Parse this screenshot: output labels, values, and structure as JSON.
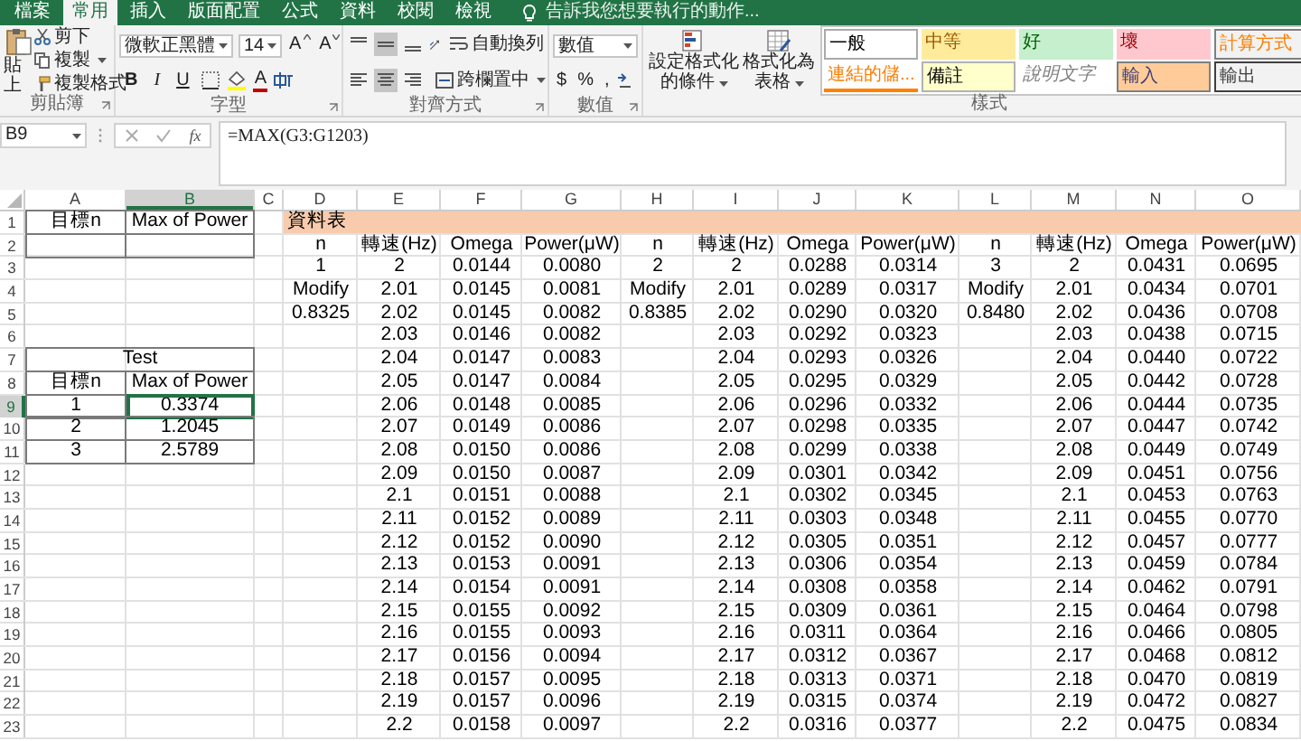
{
  "ribbon_tabs": [
    {
      "label": "檔案",
      "selected": false
    },
    {
      "label": "常用",
      "selected": true
    },
    {
      "label": "插入",
      "selected": false
    },
    {
      "label": "版面配置",
      "selected": false
    },
    {
      "label": "公式",
      "selected": false
    },
    {
      "label": "資料",
      "selected": false
    },
    {
      "label": "校閱",
      "selected": false
    },
    {
      "label": "檢視",
      "selected": false
    }
  ],
  "tell_me": "告訴我您想要執行的動作...",
  "clipboard": {
    "paste": "貼上",
    "cut": "剪下",
    "copy": "複製",
    "format_painter": "複製格式",
    "group": "剪貼簿"
  },
  "font": {
    "name": "微軟正黑體",
    "size": "14",
    "grow": "A",
    "shrink": "A",
    "styles": [
      {
        "kind": "bold",
        "label": "B"
      },
      {
        "kind": "italic",
        "label": "I"
      },
      {
        "kind": "underline",
        "label": "U"
      }
    ],
    "color_button": "A",
    "group": "字型"
  },
  "alignment": {
    "vertical": [
      {
        "kind": "top",
        "selected": false
      },
      {
        "kind": "middle",
        "selected": true
      },
      {
        "kind": "bottom",
        "selected": false
      }
    ],
    "horizontal": [
      {
        "kind": "left",
        "selected": false
      },
      {
        "kind": "center",
        "selected": true
      },
      {
        "kind": "right",
        "selected": false
      }
    ],
    "wrap": "自動換列",
    "merge": "跨欄置中",
    "group": "對齊方式"
  },
  "number": {
    "format": "數值",
    "buttons": [
      "$",
      "%",
      ","
    ],
    "group": "數值"
  },
  "styles": {
    "conditional": "設定格式化的條件",
    "as_table": "格式化為表格",
    "group": "樣式",
    "gallery": [
      {
        "label": "一般",
        "kind": "normal"
      },
      {
        "label": "中等",
        "kind": "neutral"
      },
      {
        "label": "好",
        "kind": "good"
      },
      {
        "label": "壞",
        "kind": "bad"
      },
      {
        "label": "計算方式",
        "kind": "calculation"
      },
      {
        "label": "連結的儲...",
        "kind": "linked"
      },
      {
        "label": "備註",
        "kind": "note"
      },
      {
        "label": "說明文字",
        "kind": "explanatory"
      },
      {
        "label": "輸入",
        "kind": "input"
      },
      {
        "label": "輸出",
        "kind": "output"
      }
    ]
  },
  "formula_bar": {
    "name_box": "B9",
    "function_label": "fx",
    "formula": "=MAX(G3:G1203)"
  },
  "sheet": {
    "columns": [
      {
        "label": "A",
        "selected": false
      },
      {
        "label": "B",
        "selected": true
      },
      {
        "label": "C",
        "selected": false
      },
      {
        "label": "D",
        "selected": false
      },
      {
        "label": "E",
        "selected": false
      },
      {
        "label": "F",
        "selected": false
      },
      {
        "label": "G",
        "selected": false
      },
      {
        "label": "H",
        "selected": false
      },
      {
        "label": "I",
        "selected": false
      },
      {
        "label": "J",
        "selected": false
      },
      {
        "label": "K",
        "selected": false
      },
      {
        "label": "L",
        "selected": false
      },
      {
        "label": "M",
        "selected": false
      },
      {
        "label": "N",
        "selected": false
      },
      {
        "label": "O",
        "selected": false
      }
    ],
    "rows": [
      {
        "number": "1",
        "selected": false,
        "boxed": true,
        "cells": [
          "目標n",
          "Max of Power",
          null,
          {
            "text": "資料表",
            "kind": "banner"
          },
          null,
          null,
          null,
          null,
          null,
          null,
          null,
          null,
          null,
          null,
          null
        ]
      },
      {
        "number": "2",
        "selected": false,
        "boxed": true,
        "cells": [
          null,
          null,
          null,
          "n",
          "轉速(Hz)",
          "Omega",
          "Power(μW)",
          "n",
          "轉速(Hz)",
          "Omega",
          "Power(μW)",
          "n",
          "轉速(Hz)",
          "Omega",
          "Power(μW)"
        ]
      },
      {
        "number": "3",
        "selected": false,
        "boxed": false,
        "cells": [
          null,
          null,
          null,
          "1",
          "2",
          "0.0144",
          "0.0080",
          "2",
          "2",
          "0.0288",
          "0.0314",
          "3",
          "2",
          "0.0431",
          "0.0695"
        ]
      },
      {
        "number": "4",
        "selected": false,
        "boxed": false,
        "cells": [
          null,
          null,
          null,
          "Modify",
          "2.01",
          "0.0145",
          "0.0081",
          "Modify",
          "2.01",
          "0.0289",
          "0.0317",
          "Modify",
          "2.01",
          "0.0434",
          "0.0701"
        ]
      },
      {
        "number": "5",
        "selected": false,
        "boxed": false,
        "cells": [
          null,
          null,
          null,
          "0.8325",
          "2.02",
          "0.0145",
          "0.0082",
          "0.8385",
          "2.02",
          "0.0290",
          "0.0320",
          "0.8480",
          "2.02",
          "0.0436",
          "0.0708"
        ]
      },
      {
        "number": "6",
        "selected": false,
        "boxed": false,
        "cells": [
          null,
          null,
          null,
          null,
          "2.03",
          "0.0146",
          "0.0082",
          null,
          "2.03",
          "0.0292",
          "0.0323",
          null,
          "2.03",
          "0.0438",
          "0.0715"
        ]
      },
      {
        "number": "7",
        "selected": false,
        "boxed": true,
        "cells": [
          {
            "text": "Test",
            "kind": "merged"
          },
          null,
          null,
          null,
          "2.04",
          "0.0147",
          "0.0083",
          null,
          "2.04",
          "0.0293",
          "0.0326",
          null,
          "2.04",
          "0.0440",
          "0.0722"
        ]
      },
      {
        "number": "8",
        "selected": false,
        "boxed": true,
        "cells": [
          "目標n",
          "Max of Power",
          null,
          null,
          "2.05",
          "0.0147",
          "0.0084",
          null,
          "2.05",
          "0.0295",
          "0.0329",
          null,
          "2.05",
          "0.0442",
          "0.0728"
        ]
      },
      {
        "number": "9",
        "selected": true,
        "boxed": true,
        "cells": [
          "1",
          "0.3374",
          null,
          null,
          "2.06",
          "0.0148",
          "0.0085",
          null,
          "2.06",
          "0.0296",
          "0.0332",
          null,
          "2.06",
          "0.0444",
          "0.0735"
        ]
      },
      {
        "number": "10",
        "selected": false,
        "boxed": true,
        "cells": [
          "2",
          "1.2045",
          null,
          null,
          "2.07",
          "0.0149",
          "0.0086",
          null,
          "2.07",
          "0.0298",
          "0.0335",
          null,
          "2.07",
          "0.0447",
          "0.0742"
        ]
      },
      {
        "number": "11",
        "selected": false,
        "boxed": true,
        "cells": [
          "3",
          "2.5789",
          null,
          null,
          "2.08",
          "0.0150",
          "0.0086",
          null,
          "2.08",
          "0.0299",
          "0.0338",
          null,
          "2.08",
          "0.0449",
          "0.0749"
        ]
      },
      {
        "number": "12",
        "selected": false,
        "boxed": false,
        "cells": [
          null,
          null,
          null,
          null,
          "2.09",
          "0.0150",
          "0.0087",
          null,
          "2.09",
          "0.0301",
          "0.0342",
          null,
          "2.09",
          "0.0451",
          "0.0756"
        ]
      },
      {
        "number": "13",
        "selected": false,
        "boxed": false,
        "cells": [
          null,
          null,
          null,
          null,
          "2.1",
          "0.0151",
          "0.0088",
          null,
          "2.1",
          "0.0302",
          "0.0345",
          null,
          "2.1",
          "0.0453",
          "0.0763"
        ]
      },
      {
        "number": "14",
        "selected": false,
        "boxed": false,
        "cells": [
          null,
          null,
          null,
          null,
          "2.11",
          "0.0152",
          "0.0089",
          null,
          "2.11",
          "0.0303",
          "0.0348",
          null,
          "2.11",
          "0.0455",
          "0.0770"
        ]
      },
      {
        "number": "15",
        "selected": false,
        "boxed": false,
        "cells": [
          null,
          null,
          null,
          null,
          "2.12",
          "0.0152",
          "0.0090",
          null,
          "2.12",
          "0.0305",
          "0.0351",
          null,
          "2.12",
          "0.0457",
          "0.0777"
        ]
      },
      {
        "number": "16",
        "selected": false,
        "boxed": false,
        "cells": [
          null,
          null,
          null,
          null,
          "2.13",
          "0.0153",
          "0.0091",
          null,
          "2.13",
          "0.0306",
          "0.0354",
          null,
          "2.13",
          "0.0459",
          "0.0784"
        ]
      },
      {
        "number": "17",
        "selected": false,
        "boxed": false,
        "cells": [
          null,
          null,
          null,
          null,
          "2.14",
          "0.0154",
          "0.0091",
          null,
          "2.14",
          "0.0308",
          "0.0358",
          null,
          "2.14",
          "0.0462",
          "0.0791"
        ]
      },
      {
        "number": "18",
        "selected": false,
        "boxed": false,
        "cells": [
          null,
          null,
          null,
          null,
          "2.15",
          "0.0155",
          "0.0092",
          null,
          "2.15",
          "0.0309",
          "0.0361",
          null,
          "2.15",
          "0.0464",
          "0.0798"
        ]
      },
      {
        "number": "19",
        "selected": false,
        "boxed": false,
        "cells": [
          null,
          null,
          null,
          null,
          "2.16",
          "0.0155",
          "0.0093",
          null,
          "2.16",
          "0.0311",
          "0.0364",
          null,
          "2.16",
          "0.0466",
          "0.0805"
        ]
      },
      {
        "number": "20",
        "selected": false,
        "boxed": false,
        "cells": [
          null,
          null,
          null,
          null,
          "2.17",
          "0.0156",
          "0.0094",
          null,
          "2.17",
          "0.0312",
          "0.0367",
          null,
          "2.17",
          "0.0468",
          "0.0812"
        ]
      },
      {
        "number": "21",
        "selected": false,
        "boxed": false,
        "cells": [
          null,
          null,
          null,
          null,
          "2.18",
          "0.0157",
          "0.0095",
          null,
          "2.18",
          "0.0313",
          "0.0371",
          null,
          "2.18",
          "0.0470",
          "0.0819"
        ]
      },
      {
        "number": "22",
        "selected": false,
        "boxed": false,
        "cells": [
          null,
          null,
          null,
          null,
          "2.19",
          "0.0157",
          "0.0096",
          null,
          "2.19",
          "0.0315",
          "0.0374",
          null,
          "2.19",
          "0.0472",
          "0.0827"
        ]
      },
      {
        "number": "23",
        "selected": false,
        "boxed": false,
        "cells": [
          null,
          null,
          null,
          null,
          "2.2",
          "0.0158",
          "0.0097",
          null,
          "2.2",
          "0.0316",
          "0.0377",
          null,
          "2.2",
          "0.0475",
          "0.0834"
        ]
      }
    ]
  }
}
